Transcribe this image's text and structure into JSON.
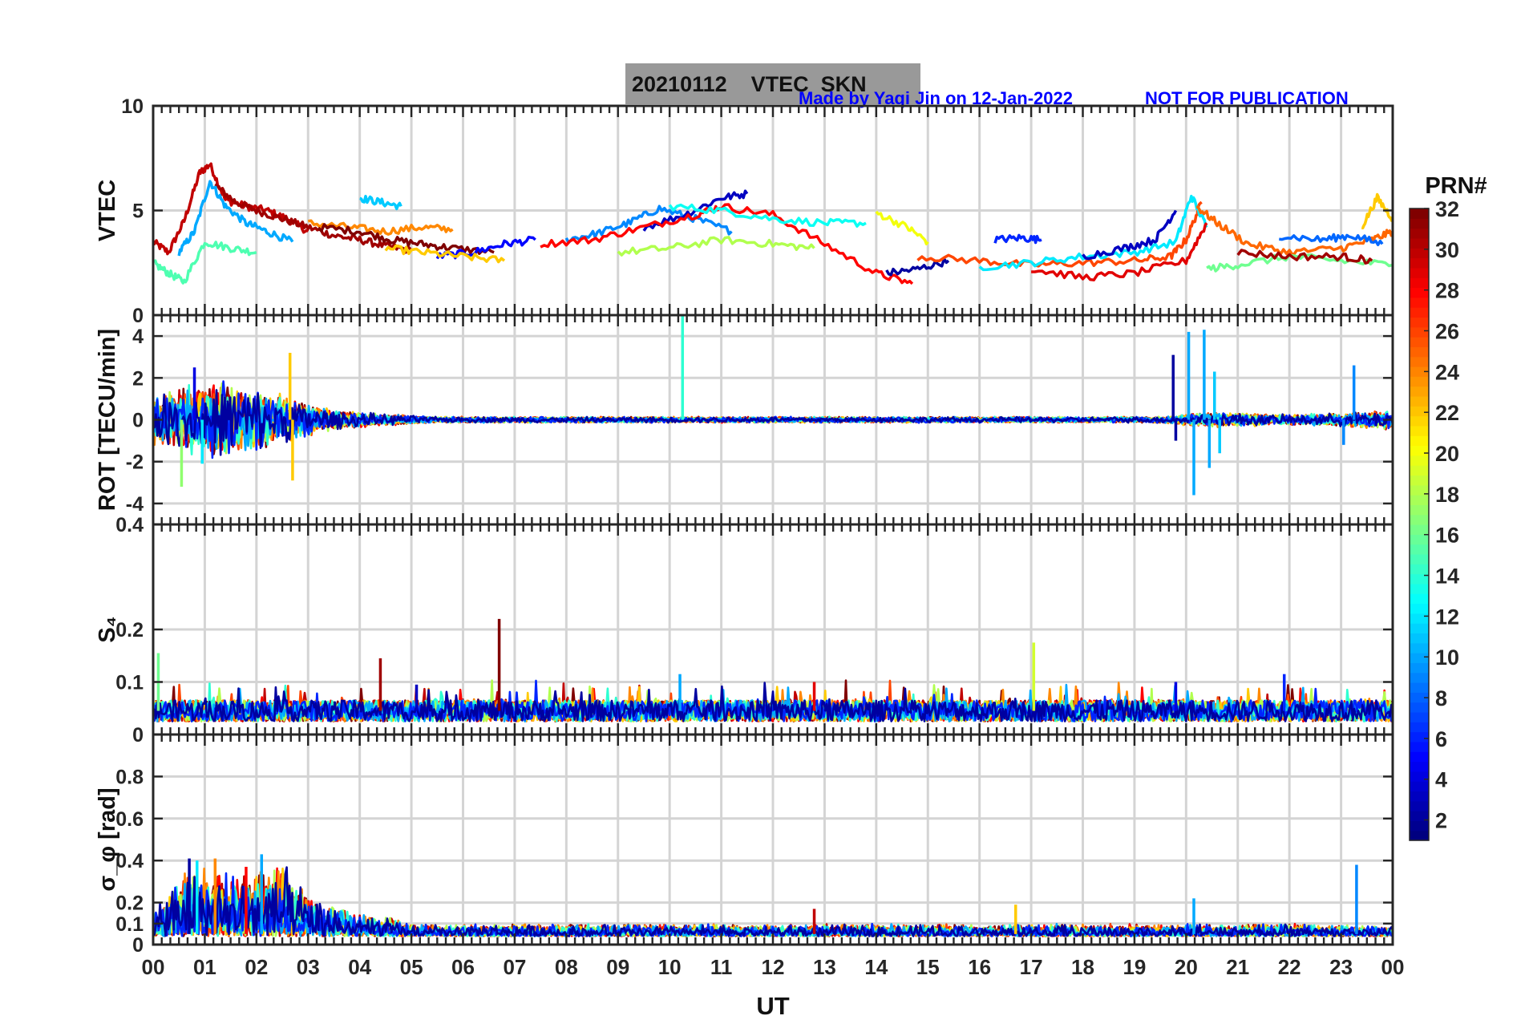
{
  "figure": {
    "title": "20210112    VTEC  SKN",
    "credit": "Made by Yaqi Jin on 12-Jan-2022",
    "notice": "NOT FOR PUBLICATION",
    "xlabel": "UT",
    "xticks": [
      "00",
      "01",
      "02",
      "03",
      "04",
      "05",
      "06",
      "07",
      "08",
      "09",
      "10",
      "11",
      "12",
      "13",
      "14",
      "15",
      "16",
      "17",
      "18",
      "19",
      "20",
      "21",
      "22",
      "23",
      "00"
    ],
    "colorbar": {
      "label": "PRN#",
      "ticks": [
        "32",
        "30",
        "28",
        "26",
        "24",
        "22",
        "20",
        "18",
        "16",
        "14",
        "12",
        "10",
        "8",
        "6",
        "4",
        "2"
      ],
      "colormap": "jet",
      "range": [
        1,
        32
      ]
    }
  },
  "chart_data": [
    {
      "type": "line",
      "panel": "VTEC",
      "ylabel": "VTEC",
      "ylim": [
        0,
        10
      ],
      "yticks": [
        "10",
        "5",
        "0"
      ],
      "grid": true,
      "x_units": "UT hours",
      "series": [
        {
          "prn": 30,
          "x": [
            0.0,
            0.3,
            0.6,
            0.9,
            1.1,
            1.4,
            1.8,
            2.2,
            2.6,
            3.0
          ],
          "y": [
            3.5,
            3.0,
            4.5,
            6.8,
            7.2,
            5.5,
            5.2,
            5.0,
            4.6,
            4.0
          ]
        },
        {
          "prn": 31,
          "x": [
            1.2,
            1.6,
            2.0,
            2.5,
            3.0,
            3.5,
            4.0,
            4.5,
            5.0
          ],
          "y": [
            6.2,
            5.4,
            5.0,
            4.6,
            4.2,
            3.8,
            3.6,
            3.3,
            3.1
          ]
        },
        {
          "prn": 10,
          "x": [
            0.5,
            0.8,
            1.1,
            1.4,
            1.8,
            2.2,
            2.7
          ],
          "y": [
            3.0,
            4.0,
            6.4,
            5.2,
            4.4,
            4.0,
            3.5
          ]
        },
        {
          "prn": 15,
          "x": [
            0.0,
            0.3,
            0.6,
            1.0,
            1.5,
            2.0
          ],
          "y": [
            2.5,
            2.0,
            1.6,
            3.5,
            3.2,
            3.0
          ]
        },
        {
          "prn": 11,
          "x": [
            4.0,
            4.4,
            4.8
          ],
          "y": [
            5.6,
            5.4,
            5.2
          ]
        },
        {
          "prn": 24,
          "x": [
            3.0,
            3.8,
            4.5,
            5.2,
            5.8
          ],
          "y": [
            4.4,
            4.2,
            4.0,
            4.2,
            4.1
          ]
        },
        {
          "prn": 32,
          "x": [
            3.2,
            4.0,
            4.6,
            5.2,
            5.8,
            6.6
          ],
          "y": [
            4.2,
            4.0,
            3.6,
            3.4,
            3.2,
            3.0
          ]
        },
        {
          "prn": 5,
          "x": [
            5.5,
            6.2,
            6.8,
            7.4
          ],
          "y": [
            2.8,
            3.0,
            3.4,
            3.6
          ]
        },
        {
          "prn": 22,
          "x": [
            4.5,
            5.2,
            6.0,
            6.8
          ],
          "y": [
            3.2,
            3.0,
            2.8,
            2.6
          ]
        },
        {
          "prn": 9,
          "x": [
            8.0,
            8.6,
            9.2,
            9.8,
            10.5,
            11.2
          ],
          "y": [
            3.6,
            3.9,
            4.4,
            5.1,
            4.6,
            4.0
          ]
        },
        {
          "prn": 3,
          "x": [
            9.5,
            10.3,
            11.0,
            11.5
          ],
          "y": [
            4.2,
            4.8,
            5.6,
            5.8
          ]
        },
        {
          "prn": 28,
          "x": [
            7.5,
            8.5,
            9.5,
            10.5,
            11.0,
            12.0,
            13.0,
            14.0,
            14.7
          ],
          "y": [
            3.4,
            3.6,
            4.2,
            4.8,
            5.2,
            4.8,
            3.4,
            2.0,
            1.5
          ]
        },
        {
          "prn": 13,
          "x": [
            10.0,
            11.0,
            12.0,
            13.0,
            13.8
          ],
          "y": [
            5.2,
            5.0,
            4.6,
            4.4,
            4.4
          ]
        },
        {
          "prn": 18,
          "x": [
            9.0,
            10.0,
            11.0,
            12.0,
            12.8
          ],
          "y": [
            3.0,
            3.2,
            3.6,
            3.4,
            3.2
          ]
        },
        {
          "prn": 20,
          "x": [
            14.0,
            14.6,
            15.0
          ],
          "y": [
            4.9,
            4.2,
            3.5
          ]
        },
        {
          "prn": 2,
          "x": [
            14.2,
            14.8,
            15.4
          ],
          "y": [
            2.0,
            2.2,
            2.6
          ]
        },
        {
          "prn": 6,
          "x": [
            16.3,
            16.8,
            17.2
          ],
          "y": [
            3.6,
            3.7,
            3.6
          ]
        },
        {
          "prn": 26,
          "x": [
            14.8,
            16.0,
            17.0,
            18.0,
            19.0,
            19.7,
            20.0,
            20.3
          ],
          "y": [
            2.8,
            2.6,
            2.4,
            2.5,
            2.6,
            2.8,
            3.6,
            5.4
          ]
        },
        {
          "prn": 12,
          "x": [
            16.0,
            17.0,
            18.0,
            19.0,
            19.8,
            20.1,
            20.4
          ],
          "y": [
            2.3,
            2.5,
            2.8,
            3.0,
            3.5,
            5.7,
            4.2
          ]
        },
        {
          "prn": 3,
          "x": [
            18.0,
            18.8,
            19.4,
            19.8
          ],
          "y": [
            2.8,
            3.2,
            3.6,
            5.0
          ]
        },
        {
          "prn": 29,
          "x": [
            17.0,
            18.0,
            19.0,
            20.0,
            20.4
          ],
          "y": [
            2.2,
            1.8,
            2.0,
            2.6,
            4.4
          ]
        },
        {
          "prn": 25,
          "x": [
            20.2,
            20.6,
            21.2,
            22.0,
            23.0,
            23.6,
            24.0
          ],
          "y": [
            5.2,
            4.4,
            3.4,
            3.0,
            3.2,
            3.6,
            4.0
          ]
        },
        {
          "prn": 16,
          "x": [
            20.4,
            21.0,
            22.0,
            23.0,
            24.0
          ],
          "y": [
            2.2,
            2.4,
            2.8,
            2.6,
            2.4
          ]
        },
        {
          "prn": 8,
          "x": [
            21.8,
            22.6,
            23.2,
            23.8
          ],
          "y": [
            3.8,
            3.6,
            3.8,
            3.4
          ]
        },
        {
          "prn": 22,
          "x": [
            23.4,
            23.7,
            24.0
          ],
          "y": [
            4.2,
            5.6,
            4.6
          ]
        },
        {
          "prn": 31,
          "x": [
            21.0,
            22.0,
            23.0,
            23.6
          ],
          "y": [
            3.0,
            2.8,
            2.8,
            2.6
          ]
        }
      ]
    },
    {
      "type": "line",
      "panel": "ROT",
      "ylabel": "ROT [TECU/min]",
      "ylim": [
        -5,
        5
      ],
      "yticks": [
        "4",
        "2",
        "0",
        "-2",
        "-4"
      ],
      "grid": true,
      "x_units": "UT hours",
      "noise_envelope": {
        "x": [
          0,
          1,
          2,
          2.8,
          3.5,
          4.5,
          5.5,
          19.5,
          20.5,
          22,
          23,
          24
        ],
        "amplitude": [
          1.2,
          2.0,
          1.6,
          1.0,
          0.5,
          0.3,
          0.15,
          0.15,
          0.4,
          0.25,
          0.35,
          0.5
        ]
      },
      "spikes": [
        {
          "prn": 14,
          "x": 10.25,
          "y": 5.0
        },
        {
          "prn": 22,
          "x": 2.65,
          "y": 3.2
        },
        {
          "prn": 22,
          "x": 2.7,
          "y": -2.9
        },
        {
          "prn": 17,
          "x": 0.55,
          "y": -3.2
        },
        {
          "prn": 4,
          "x": 0.8,
          "y": 2.5
        },
        {
          "prn": 2,
          "x": 19.75,
          "y": 3.1
        },
        {
          "prn": 2,
          "x": 19.8,
          "y": -1.0
        },
        {
          "prn": 10,
          "x": 20.05,
          "y": 4.2
        },
        {
          "prn": 10,
          "x": 20.15,
          "y": -3.6
        },
        {
          "prn": 10,
          "x": 20.35,
          "y": 4.3
        },
        {
          "prn": 10,
          "x": 20.45,
          "y": -2.3
        },
        {
          "prn": 11,
          "x": 20.55,
          "y": 2.3
        },
        {
          "prn": 11,
          "x": 20.65,
          "y": -1.6
        },
        {
          "prn": 9,
          "x": 23.25,
          "y": 2.6
        },
        {
          "prn": 9,
          "x": 23.05,
          "y": -1.2
        },
        {
          "prn": 12,
          "x": 0.95,
          "y": -2.1
        }
      ]
    },
    {
      "type": "line",
      "panel": "S4",
      "ylabel": "S₄",
      "ylim": [
        0,
        0.4
      ],
      "yticks": [
        "0.4",
        "0.2",
        "0.1",
        "0"
      ],
      "grid": true,
      "x_units": "UT hours",
      "baseline": 0.045,
      "spikes": [
        {
          "prn": 32,
          "x": 6.7,
          "y": 0.22
        },
        {
          "prn": 31,
          "x": 4.4,
          "y": 0.145
        },
        {
          "prn": 19,
          "x": 17.05,
          "y": 0.175
        },
        {
          "prn": 16,
          "x": 0.1,
          "y": 0.155
        },
        {
          "prn": 6,
          "x": 21.9,
          "y": 0.115
        },
        {
          "prn": 29,
          "x": 12.8,
          "y": 0.1
        },
        {
          "prn": 3,
          "x": 5.1,
          "y": 0.095
        },
        {
          "prn": 4,
          "x": 19.8,
          "y": 0.1
        },
        {
          "prn": 10,
          "x": 10.2,
          "y": 0.115
        }
      ]
    },
    {
      "type": "line",
      "panel": "sigma_phi",
      "ylabel": "σ_φ [rad]",
      "ylim": [
        0,
        1
      ],
      "yticks": [
        "0.8",
        "0.6",
        "0.4",
        "0.2",
        "0.1",
        "0"
      ],
      "grid": true,
      "x_units": "UT hours",
      "noise_envelope": {
        "x": [
          0,
          0.5,
          1,
          2,
          2.6,
          3,
          3.5,
          4.5,
          5,
          24
        ],
        "amplitude": [
          0.12,
          0.3,
          0.35,
          0.32,
          0.35,
          0.2,
          0.15,
          0.1,
          0.06,
          0.06
        ]
      },
      "spikes": [
        {
          "prn": 2,
          "x": 0.7,
          "y": 0.41
        },
        {
          "prn": 12,
          "x": 0.85,
          "y": 0.4
        },
        {
          "prn": 24,
          "x": 1.2,
          "y": 0.41
        },
        {
          "prn": 10,
          "x": 2.1,
          "y": 0.43
        },
        {
          "prn": 28,
          "x": 1.8,
          "y": 0.37
        },
        {
          "prn": 9,
          "x": 23.3,
          "y": 0.38
        },
        {
          "prn": 10,
          "x": 20.15,
          "y": 0.22
        },
        {
          "prn": 22,
          "x": 16.7,
          "y": 0.19
        },
        {
          "prn": 30,
          "x": 12.8,
          "y": 0.17
        }
      ]
    }
  ]
}
